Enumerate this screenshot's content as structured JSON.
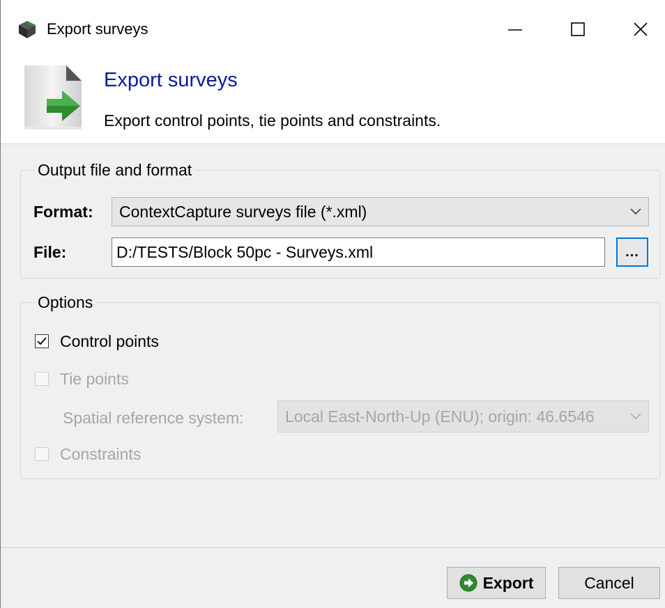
{
  "window": {
    "title": "Export surveys",
    "controls": {
      "minimize": "minimize",
      "maximize": "maximize",
      "close": "close"
    }
  },
  "header": {
    "title": "Export surveys",
    "description": "Export control points, tie points and constraints."
  },
  "output_group": {
    "title": "Output file and format",
    "format_label": "Format:",
    "format_value": "ContextCapture surveys file (*.xml)",
    "file_label": "File:",
    "file_value": "D:/TESTS/Block 50pc - Surveys.xml",
    "browse_label": "..."
  },
  "options_group": {
    "title": "Options",
    "control_points": {
      "label": "Control points",
      "checked": true,
      "enabled": true
    },
    "tie_points": {
      "label": "Tie points",
      "checked": false,
      "enabled": false
    },
    "srs_label": "Spatial reference system:",
    "srs_value": "Local East-North-Up (ENU); origin: 46.6546",
    "constraints": {
      "label": "Constraints",
      "checked": false,
      "enabled": false
    }
  },
  "footer": {
    "export_label": "Export",
    "cancel_label": "Cancel"
  },
  "colors": {
    "header_title": "#0b1b9a",
    "accent_focus": "#0078d7",
    "export_icon": "#2e8b2e",
    "disabled_text": "#a6a6a6"
  },
  "icons": {
    "app": "cube-icon",
    "header": "file-export-icon",
    "export_button": "green-arrow-circle-icon",
    "dropdown": "chevron-down-icon",
    "check": "checkmark-icon"
  }
}
